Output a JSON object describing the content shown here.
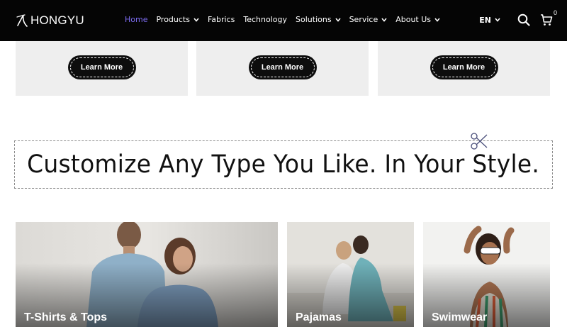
{
  "header": {
    "logo_text": "HONGYU",
    "nav": [
      {
        "label": "Home",
        "active": true,
        "dropdown": false
      },
      {
        "label": "Products",
        "active": false,
        "dropdown": true
      },
      {
        "label": "Fabrics",
        "active": false,
        "dropdown": false
      },
      {
        "label": "Technology",
        "active": false,
        "dropdown": false
      },
      {
        "label": "Solutions",
        "active": false,
        "dropdown": true
      },
      {
        "label": "Service",
        "active": false,
        "dropdown": true
      },
      {
        "label": "About Us",
        "active": false,
        "dropdown": true
      }
    ],
    "language": "EN",
    "cart_count": "0",
    "icons": [
      "search-icon",
      "cart-icon",
      "chevron-down-icon"
    ]
  },
  "cards": [
    {
      "button_label": "Learn More"
    },
    {
      "button_label": "Learn More"
    },
    {
      "button_label": "Learn More"
    }
  ],
  "banner": {
    "text": "Customize Any Type You Like. In Your Style.",
    "icon": "scissors-icon"
  },
  "categories": [
    {
      "label": "T-Shirts & Tops"
    },
    {
      "label": "Pajamas"
    },
    {
      "label": "Swimwear"
    }
  ],
  "colors": {
    "header_bg": "#050505",
    "accent": "#7c6cf0",
    "card_bg": "#eeeeee",
    "button_bg": "#0d0d0d"
  }
}
